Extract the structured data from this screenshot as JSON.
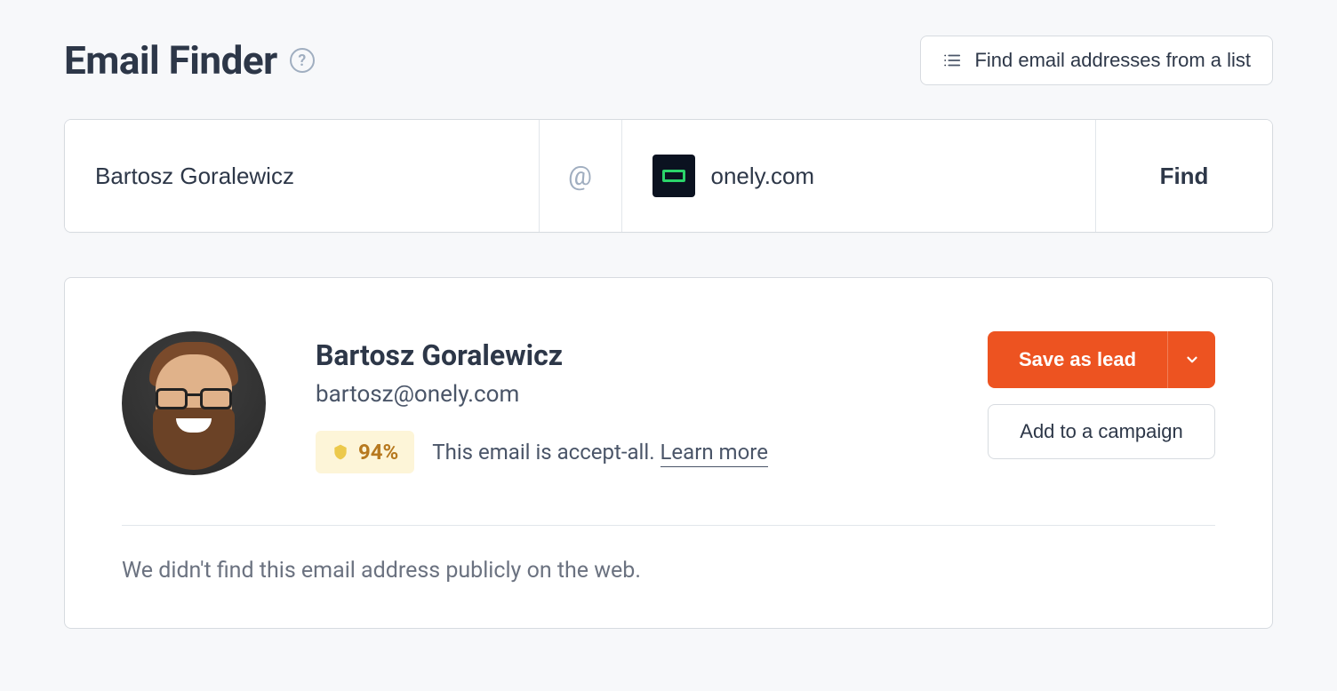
{
  "header": {
    "title": "Email Finder",
    "bulk_button_label": "Find email addresses from a list"
  },
  "search": {
    "name_value": "Bartosz Goralewicz",
    "at_symbol": "@",
    "domain_value": "onely.com",
    "find_label": "Find"
  },
  "result": {
    "name": "Bartosz Goralewicz",
    "email": "bartosz@onely.com",
    "score": "94%",
    "verify_text": "This email is accept-all. ",
    "learn_more": "Learn more",
    "save_lead_label": "Save as lead",
    "add_campaign_label": "Add to a campaign",
    "not_found_text": "We didn't find this email address publicly on the web."
  }
}
